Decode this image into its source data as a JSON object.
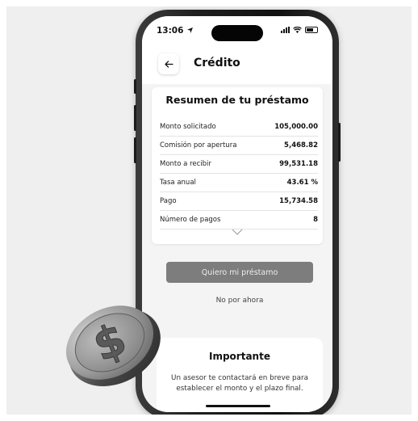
{
  "status_bar": {
    "time": "13:06",
    "location_icon": "location-arrow-icon",
    "signal_icon": "signal-icon",
    "wifi_icon": "wifi-icon",
    "battery_icon": "battery-icon"
  },
  "header": {
    "back_icon": "arrow-left-icon",
    "title": "Crédito"
  },
  "summary": {
    "title": "Resumen de tu préstamo",
    "rows": [
      {
        "label": "Monto solicitado",
        "value": "105,000.00"
      },
      {
        "label": "Comisión por apertura",
        "value": "5,468.82"
      },
      {
        "label": "Monto a recibir",
        "value": "99,531.18"
      },
      {
        "label": "Tasa anual",
        "value": "43.61 %"
      },
      {
        "label": "Pago",
        "value": "15,734.58"
      },
      {
        "label": "Número de pagos",
        "value": "8"
      }
    ],
    "expand_icon": "chevron-down-icon"
  },
  "actions": {
    "primary_label": "Quiero mi préstamo",
    "secondary_label": "No por ahora"
  },
  "important": {
    "title": "Importante",
    "text": "Un asesor te contactará en breve para establecer el monto y el plazo final."
  },
  "decoration": {
    "coin_icon": "dollar-coin-icon"
  },
  "colors": {
    "background": "#efefef",
    "screen": "#f4f4f4",
    "primary_button": "#7d7d7d",
    "phone_frame": "#1f1f1f"
  }
}
